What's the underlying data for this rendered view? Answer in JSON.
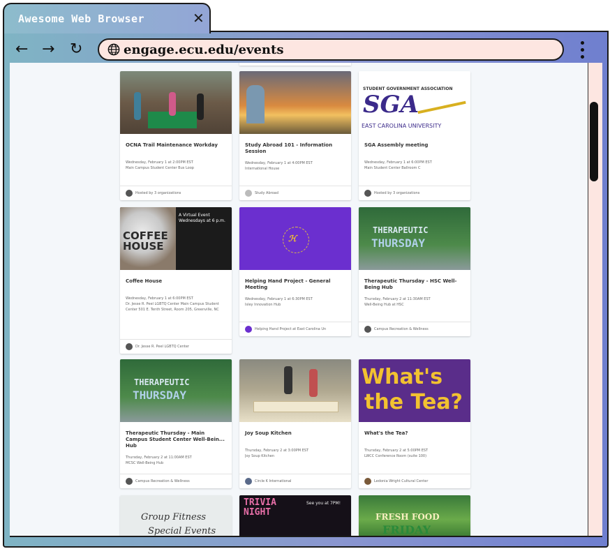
{
  "browser": {
    "tab_title": "Awesome Web Browser",
    "tab_close": "✕",
    "back": "←",
    "forward": "→",
    "reload": "↻",
    "url": "engage.ecu.edu/events"
  },
  "events": [
    {
      "title": "OCNA Trail Maintenance Workday",
      "date": "Wednesday, February 1 at 2:00PM EST",
      "location": "Main Campus Student Center Bus Loop",
      "host": "Hosted by 3 organizations"
    },
    {
      "title": "Study Abroad 101 - Information Session",
      "date": "Wednesday, February 1 at 4:00PM EST",
      "location": "International House",
      "host": "Study Abroad"
    },
    {
      "title": "SGA Assembly meeting",
      "date": "Wednesday, February 1 at 6:00PM EST",
      "location": "Main Student Center Ballroom C",
      "host": "Hosted by 3 organizations",
      "image_text": {
        "top": "STUDENT GOVERNMENT ASSOCIATION",
        "logo": "SGA",
        "bottom": "EAST CAROLINA UNIVERSITY"
      }
    },
    {
      "title": "Coffee House",
      "date": "Wednesday, February 1 at 6:00PM EST",
      "location": "Dr. Jesse R. Peel LGBTQ Center Main Campus Student Center 501 E. Tenth Street, Room 205, Greenville, NC",
      "host": "Dr. Jesse R. Peel LGBTQ Center",
      "image_text": {
        "big": "COFFEE HOUSE",
        "note": "A Virtual Event Wednesdays at 6 p.m."
      }
    },
    {
      "title": "Helping Hand Project - General Meeting",
      "date": "Wednesday, February 1 at 6:30PM EST",
      "location": "Isley Innovation Hub",
      "host": "Helping Hand Project at East Carolina Un"
    },
    {
      "title": "Therapeutic Thursday - HSC Well-Being Hub",
      "date": "Thursday, February 2 at 11:30AM EST",
      "location": "Well-Being Hub at HSC",
      "host": "Campus Recreation & Wellness",
      "image_text": {
        "line1": "THERAPEUTIC",
        "line2": "THURSDAY"
      }
    },
    {
      "title": "Therapeutic Thursday - Main Campus Student Center Well-Bein... Hub",
      "date": "Thursday, February 2 at 11:00AM EST",
      "location": "MCSC Well-Being Hub",
      "host": "Campus Recreation & Wellness",
      "image_text": {
        "line1": "THERAPEUTIC",
        "line2": "THURSDAY"
      }
    },
    {
      "title": "Joy Soup Kitchen",
      "date": "Thursday, February 2 at 3:00PM EST",
      "location": "Joy Soup Kitchen",
      "host": "Circle K International"
    },
    {
      "title": "What's the Tea?",
      "date": "Thursday, February 2 at 5:00PM EST",
      "location": "LWCC Conference Room (suite 100)",
      "host": "Ledonia Wright Cultural Center",
      "image_text": {
        "line1": "What's",
        "line2": "the Tea?"
      }
    },
    {
      "image_text": {
        "line1": "Group Fitness",
        "line2": "Special Events"
      }
    },
    {
      "image_text": {
        "line1": "TRIVIA",
        "line2": "NIGHT",
        "note": "See you at 7PM!"
      }
    },
    {
      "image_text": {
        "line1": "FRESH FOOD",
        "line2": "FRIDAY"
      }
    }
  ],
  "colors": {
    "url_bar": "#fde6e1",
    "helping_hand_purple": "#6b2fcf",
    "whats_tea_purple": "#5a2d8a",
    "whats_tea_yellow": "#f2c230"
  }
}
